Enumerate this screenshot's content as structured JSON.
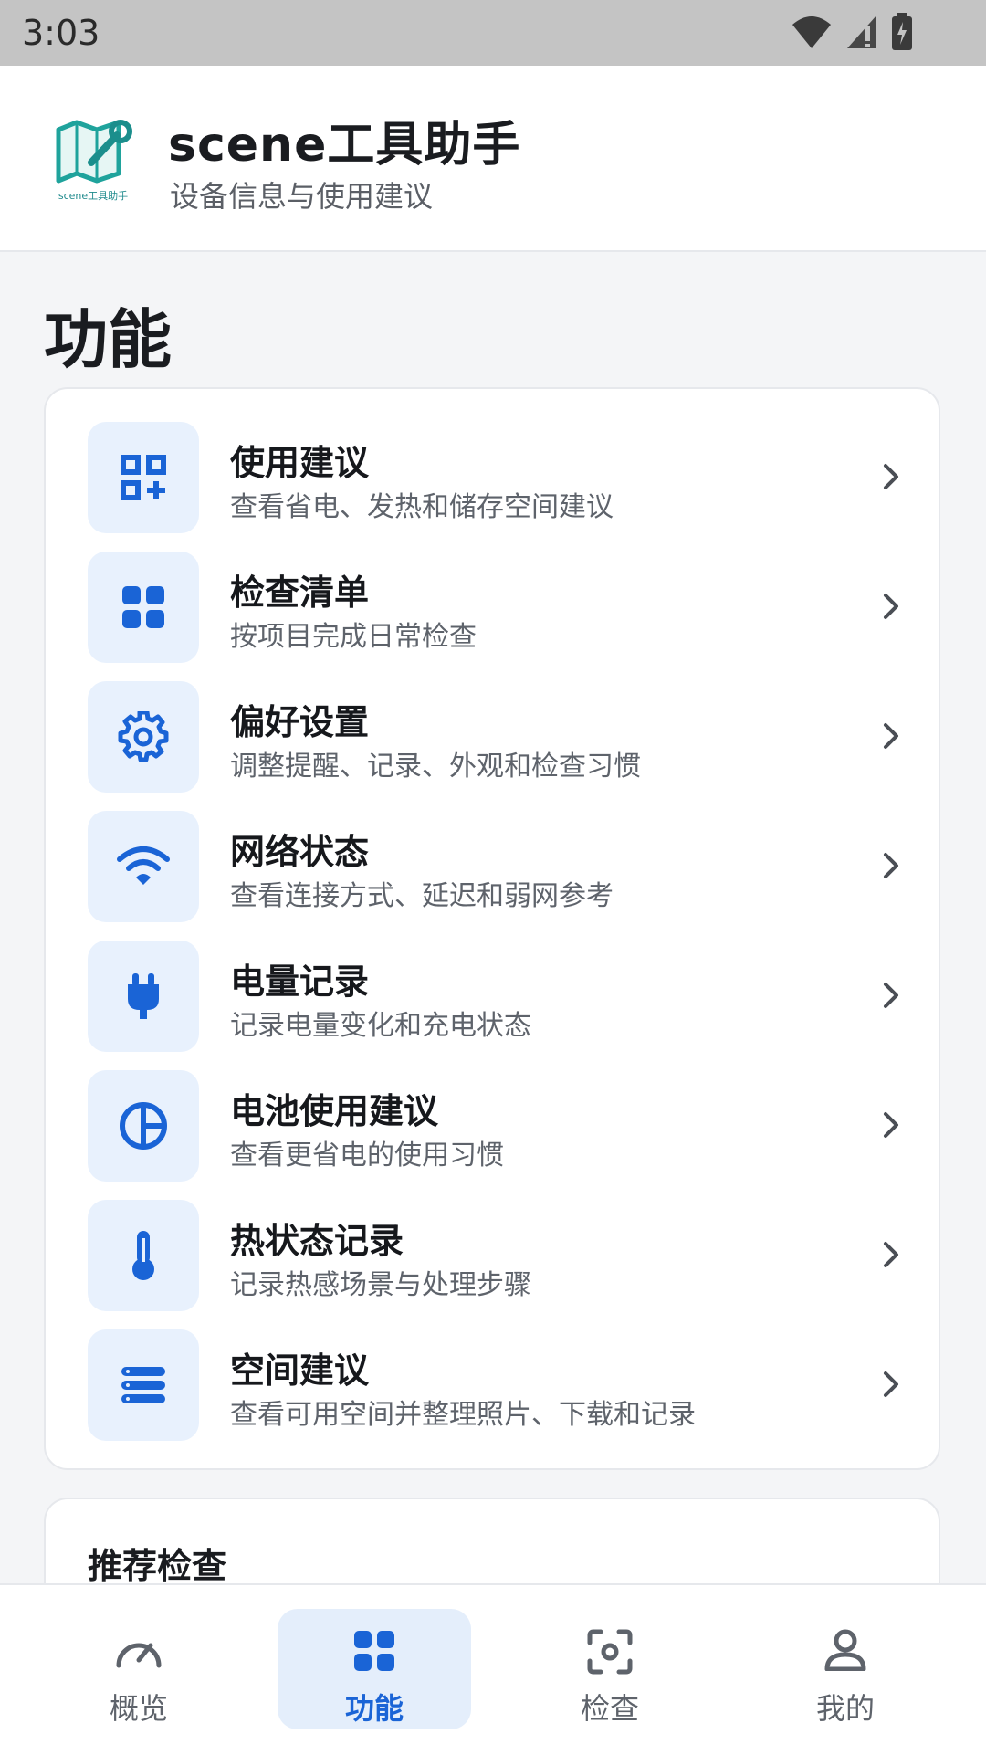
{
  "status_bar": {
    "time": "3:03"
  },
  "header": {
    "logo_text": "scene工具助手",
    "title": "scene工具助手",
    "subtitle": "设备信息与使用建议"
  },
  "section_title": "功能",
  "features": [
    {
      "title": "使用建议",
      "desc": "查看省电、发热和储存空间建议",
      "icon": "qr-code-icon"
    },
    {
      "title": "检查清单",
      "desc": "按项目完成日常检查",
      "icon": "grid-icon"
    },
    {
      "title": "偏好设置",
      "desc": "调整提醒、记录、外观和检查习惯",
      "icon": "gear-icon"
    },
    {
      "title": "网络状态",
      "desc": "查看连接方式、延迟和弱网参考",
      "icon": "wifi-icon"
    },
    {
      "title": "电量记录",
      "desc": "记录电量变化和充电状态",
      "icon": "plug-icon"
    },
    {
      "title": "电池使用建议",
      "desc": "查看更省电的使用习惯",
      "icon": "pie-chart-icon"
    },
    {
      "title": "热状态记录",
      "desc": "记录热感场景与处理步骤",
      "icon": "thermometer-icon"
    },
    {
      "title": "空间建议",
      "desc": "查看可用空间并整理照片、下载和记录",
      "icon": "storage-icon"
    }
  ],
  "recommend": {
    "title": "推荐检查"
  },
  "bottom_nav": [
    {
      "label": "概览",
      "icon": "speedometer-icon",
      "active": false
    },
    {
      "label": "功能",
      "icon": "grid-icon",
      "active": true
    },
    {
      "label": "检查",
      "icon": "scan-icon",
      "active": false
    },
    {
      "label": "我的",
      "icon": "person-icon",
      "active": false
    }
  ],
  "colors": {
    "accent": "#1a64d6",
    "icon_bg": "#e8f1fd"
  }
}
